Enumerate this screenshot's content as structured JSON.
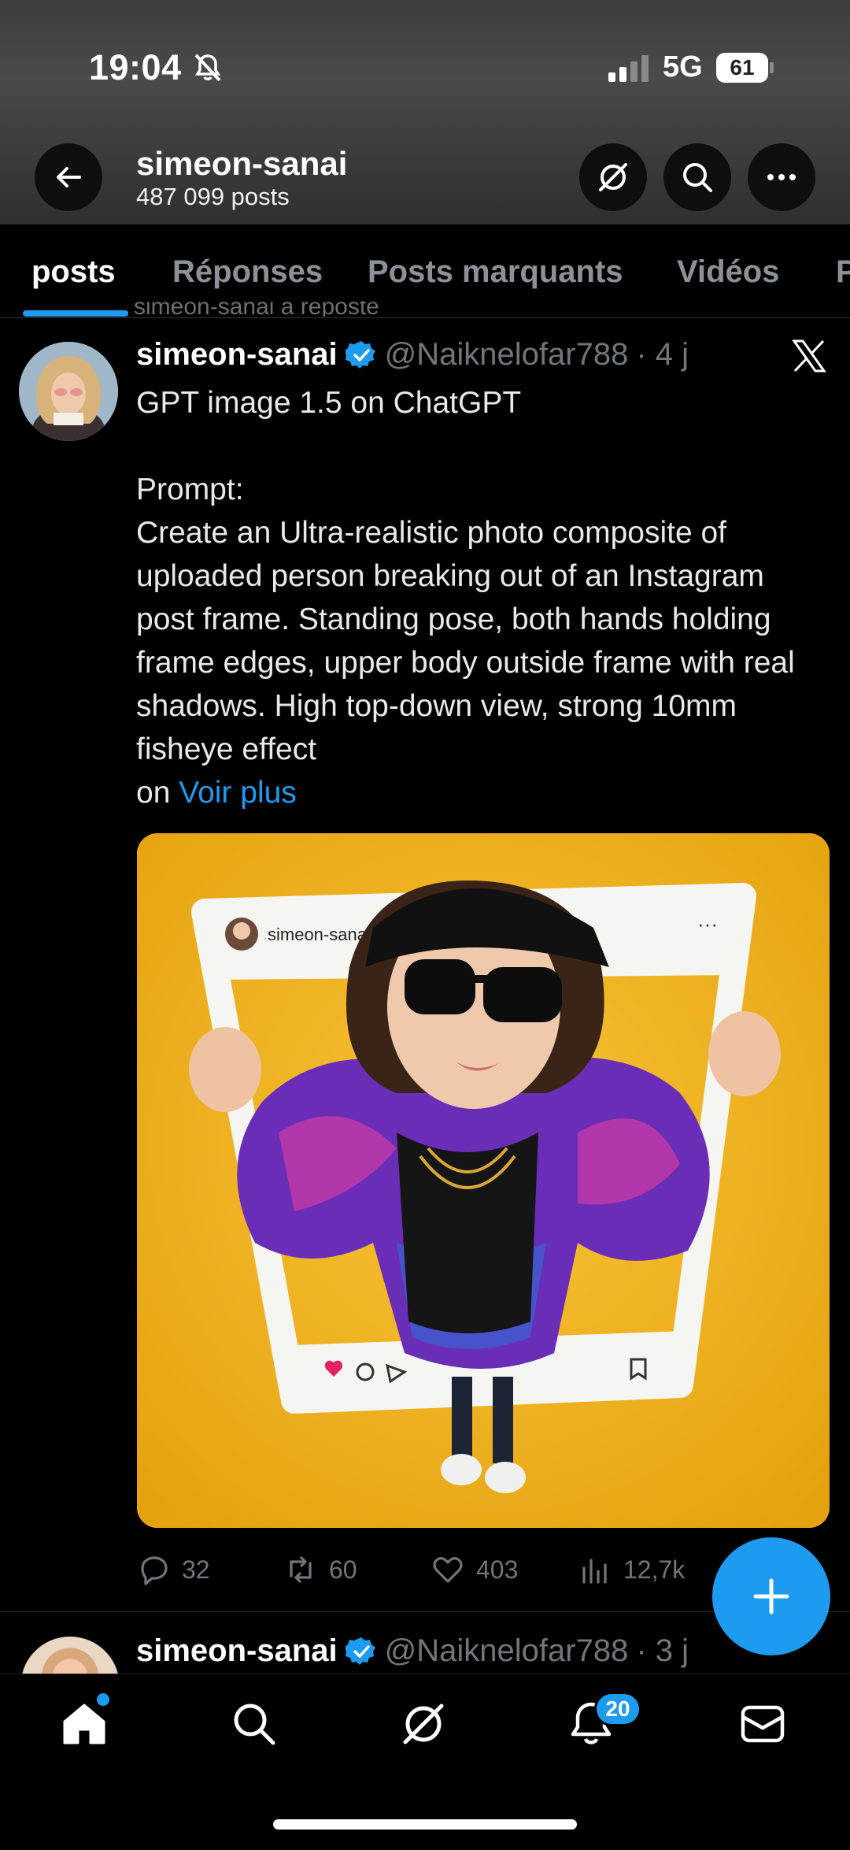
{
  "status_bar": {
    "time": "19:04",
    "network": "5G",
    "battery": "61"
  },
  "header": {
    "title": "simeon-sanai",
    "subtitle": "487 099 posts"
  },
  "tabs": [
    {
      "label": "posts",
      "active": true
    },
    {
      "label": "Réponses",
      "active": false
    },
    {
      "label": "Posts marquants",
      "active": false
    },
    {
      "label": "Vidéos",
      "active": false
    },
    {
      "label": "P",
      "active": false
    }
  ],
  "post": {
    "repost_line": "simeon-sanai a reposté",
    "name": "simeon-sanai",
    "handle": "@Naiknelofar788",
    "age": "· 4 j",
    "text": "GPT image 1.5 on ChatGPT\n\nPrompt:\nCreate an Ultra-realistic photo composite of uploaded person breaking out of an Instagram post frame. Standing pose, both hands holding frame edges, upper body outside frame with real shadows. High top-down view, strong 10mm fisheye effect\non ",
    "more": "Voir plus",
    "media": {
      "frame_username": "simeon-sanai",
      "frame_menu": "···"
    },
    "stats": {
      "replies": "32",
      "reposts": "60",
      "likes": "403",
      "views": "12,7k"
    }
  },
  "next_post": {
    "name": "simeon-sanai",
    "handle": "@Naiknelofar788",
    "age": "· 3 j"
  },
  "bottom_nav": {
    "notifications_badge": "20"
  },
  "colors": {
    "accent": "#1d9bf0",
    "background": "#000000",
    "muted_text": "#71767b",
    "media_background": "#f0b21c"
  }
}
